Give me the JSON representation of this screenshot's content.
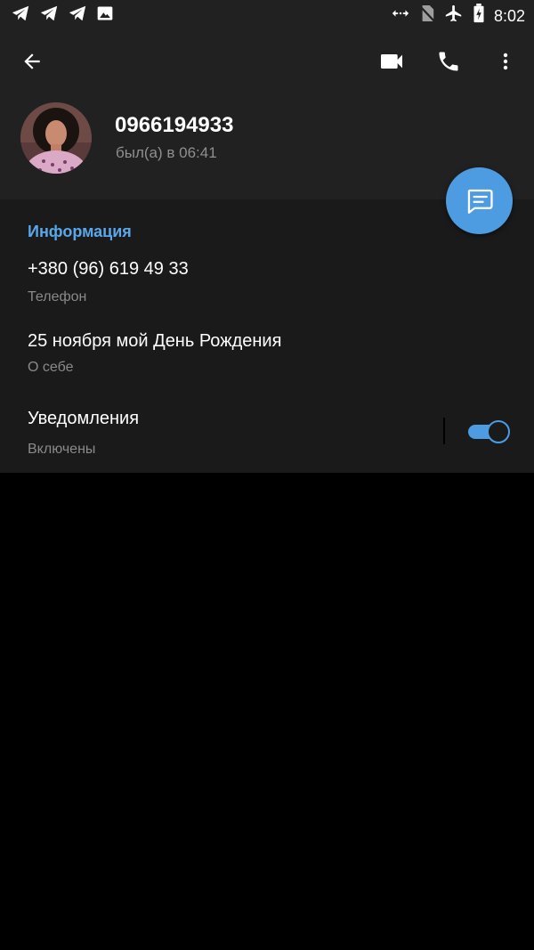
{
  "status_bar": {
    "time": "8:02",
    "left_icons": [
      "telegram-icon",
      "telegram-icon",
      "telegram-icon",
      "image-icon"
    ],
    "right_icons": [
      "data-sync-icon",
      "no-sim-icon",
      "airplane-icon",
      "battery-charging-icon"
    ]
  },
  "toolbar": {
    "icons": [
      "back-arrow-icon",
      "video-camera-icon",
      "phone-icon",
      "more-vert-icon"
    ]
  },
  "profile": {
    "name": "0966194933",
    "last_seen": "был(а) в 06:41"
  },
  "fab": {
    "icon": "message-icon"
  },
  "info": {
    "title": "Информация",
    "phone": {
      "value": "+380 (96) 619 49 33",
      "label": "Телефон"
    },
    "bio": {
      "value": "25 ноября мой День Рождения",
      "label": "О себе"
    },
    "notifications": {
      "value": "Уведомления",
      "label": "Включены",
      "enabled": true
    }
  },
  "colors": {
    "accent": "#4d9be0",
    "section_title": "#5aa7ea",
    "header_bg": "#212121",
    "info_bg": "#1a1a1a",
    "page_bg": "#000000"
  }
}
